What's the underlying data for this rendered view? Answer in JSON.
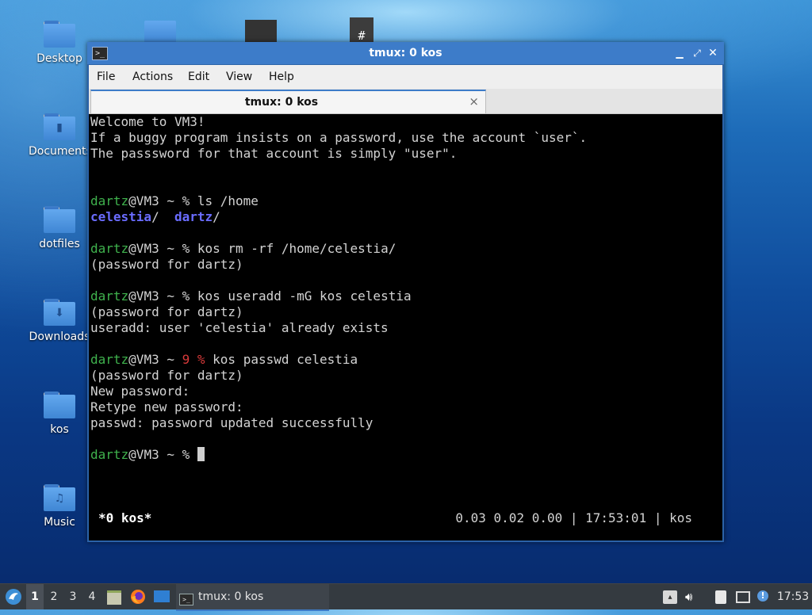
{
  "desktop": {
    "icons": [
      {
        "label": "Desktop",
        "icon": "folder-icon"
      },
      {
        "label": "Documents",
        "icon": "folder-documents-icon"
      },
      {
        "label": "dotfiles",
        "icon": "folder-icon"
      },
      {
        "label": "Downloads",
        "icon": "folder-download-icon"
      },
      {
        "label": "kos",
        "icon": "folder-icon"
      },
      {
        "label": "Music",
        "icon": "folder-music-icon"
      }
    ]
  },
  "window": {
    "title": "tmux: 0 kos",
    "app_icon": "terminal-icon",
    "controls": [
      "minimize",
      "restore",
      "close"
    ],
    "menu": [
      "File",
      "Actions",
      "Edit",
      "View",
      "Help"
    ],
    "tab": {
      "label": "tmux: 0 kos",
      "close": "×"
    }
  },
  "terminal": {
    "lines": {
      "l1": "Welcome to VM3!",
      "l2": "If a buggy program insists on a password, use the account `user`.",
      "l3": "The passsword for that account is simply \"user\".",
      "prompt_user": "dartz",
      "prompt_host": "@VM3 ~ ",
      "cmd1": "ls /home",
      "ls_1": "celestia",
      "ls_2": "dartz",
      "cmd2": "kos rm -rf /home/celestia/",
      "pw": "(password for dartz)",
      "cmd3": "kos useradd -mG kos celestia",
      "err3": "useradd: user 'celestia' already exists",
      "exit_code": "9",
      "cmd4": "kos passwd celestia",
      "np": "New password:",
      "rnp": "Retype new password:",
      "ok": "passwd: password updated successfully"
    },
    "status": {
      "left": "*0 kos*",
      "right": "0.03 0.02 0.00 | 17:53:01 | kos"
    }
  },
  "taskbar": {
    "workspaces": [
      "1",
      "2",
      "3",
      "4"
    ],
    "active_workspace": "1",
    "task_label": "tmux: 0 kos",
    "clock": "17:53"
  },
  "colors": {
    "prompt_green": "#3fb24d",
    "dir_blue": "#6a6cff",
    "error_red": "#d83a3a",
    "title_blue": "#3d7cc9"
  }
}
